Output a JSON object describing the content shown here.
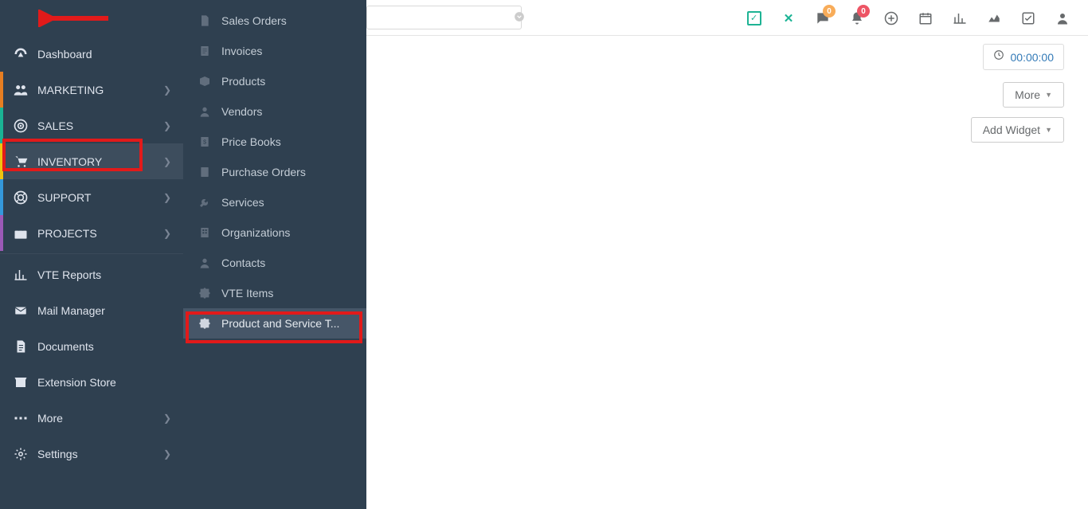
{
  "topbar": {
    "search_placeholder": "",
    "search_value": "",
    "chat_badge": "0",
    "bell_badge": "0"
  },
  "timer": {
    "value": "00:00:00"
  },
  "buttons": {
    "more": "More",
    "add_widget": "Add Widget"
  },
  "sidebar": {
    "dashboard": "Dashboard",
    "marketing": "MARKETING",
    "sales": "SALES",
    "inventory": "INVENTORY",
    "support": "SUPPORT",
    "projects": "PROJECTS",
    "vte_reports": "VTE Reports",
    "mail_manager": "Mail Manager",
    "documents": "Documents",
    "extension_store": "Extension Store",
    "more": "More",
    "settings": "Settings"
  },
  "submenu": {
    "sales_orders": "Sales Orders",
    "invoices": "Invoices",
    "products": "Products",
    "vendors": "Vendors",
    "price_books": "Price Books",
    "purchase_orders": "Purchase Orders",
    "services": "Services",
    "organizations": "Organizations",
    "contacts": "Contacts",
    "vte_items": "VTE Items",
    "product_service": "Product and Service T..."
  }
}
